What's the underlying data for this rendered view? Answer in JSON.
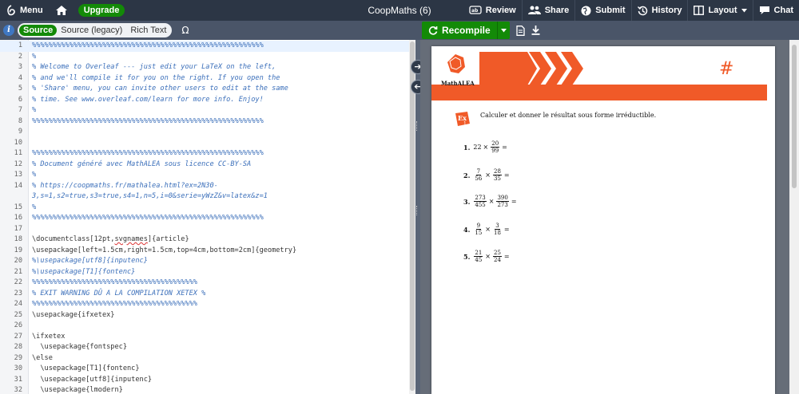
{
  "topbar": {
    "menu_label": "Menu",
    "upgrade_label": "Upgrade",
    "project_title": "CoopMaths (6)",
    "review_label": "Review",
    "share_label": "Share",
    "submit_label": "Submit",
    "history_label": "History",
    "layout_label": "Layout",
    "chat_label": "Chat"
  },
  "editor_toolbar": {
    "modes": [
      "Source",
      "Source (legacy)",
      "Rich Text"
    ],
    "active_mode": "Source",
    "omega": "Ω"
  },
  "preview_toolbar": {
    "recompile_label": "Recompile"
  },
  "code": [
    {
      "n": "1",
      "t": "%%%%%%%%%%%%%%%%%%%%%%%%%%%%%%%%%%%%%%%%%%%%%%%%%%%%%%%%",
      "k": "comment"
    },
    {
      "n": "2",
      "t": "%",
      "k": "comment"
    },
    {
      "n": "3",
      "t": "% Welcome to Overleaf --- just edit your LaTeX on the left,",
      "k": "comment"
    },
    {
      "n": "4",
      "t": "% and we'll compile it for you on the right. If you open the",
      "k": "comment"
    },
    {
      "n": "5",
      "t": "% 'Share' menu, you can invite other users to edit at the same",
      "k": "comment"
    },
    {
      "n": "6",
      "t": "% time. See www.overleaf.com/learn for more info. Enjoy!",
      "k": "comment"
    },
    {
      "n": "7",
      "t": "%",
      "k": "comment"
    },
    {
      "n": "8",
      "t": "%%%%%%%%%%%%%%%%%%%%%%%%%%%%%%%%%%%%%%%%%%%%%%%%%%%%%%%%",
      "k": "comment"
    },
    {
      "n": "9",
      "t": "",
      "k": "plain"
    },
    {
      "n": "10",
      "t": "",
      "k": "plain"
    },
    {
      "n": "11",
      "t": "%%%%%%%%%%%%%%%%%%%%%%%%%%%%%%%%%%%%%%%%%%%%%%%%%%%%%%%%",
      "k": "comment"
    },
    {
      "n": "12",
      "t": "% Document généré avec MathALEA sous licence CC-BY-SA",
      "k": "comment"
    },
    {
      "n": "13",
      "t": "%",
      "k": "comment"
    },
    {
      "n": "14",
      "t": "% https://coopmaths.fr/mathalea.html?ex=2N30-",
      "k": "comment"
    },
    {
      "n": "",
      "t": "3,s=1,s2=true,s3=true,s4=1,n=5,i=0&serie=yWzZ&v=latex&z=1",
      "k": "comment"
    },
    {
      "n": "15",
      "t": "%",
      "k": "comment"
    },
    {
      "n": "16",
      "t": "%%%%%%%%%%%%%%%%%%%%%%%%%%%%%%%%%%%%%%%%%%%%%%%%%%%%%%%%",
      "k": "comment"
    },
    {
      "n": "17",
      "t": "",
      "k": "plain"
    },
    {
      "n": "18",
      "t": "\\documentclass[12pt,svgnames]{article}",
      "k": "cmd"
    },
    {
      "n": "19",
      "t": "\\usepackage[left=1.5cm,right=1.5cm,top=4cm,bottom=2cm]{geometry}",
      "k": "cmd"
    },
    {
      "n": "20",
      "t": "%\\usepackage[utf8]{inputenc}",
      "k": "comment"
    },
    {
      "n": "21",
      "t": "%\\usepackage[T1]{fontenc}",
      "k": "comment"
    },
    {
      "n": "22",
      "t": "%%%%%%%%%%%%%%%%%%%%%%%%%%%%%%%%%%%%%%%%",
      "k": "comment"
    },
    {
      "n": "23",
      "t": "% EXIT WARNING DÛ A LA COMPILATION XETEX %",
      "k": "comment"
    },
    {
      "n": "24",
      "t": "%%%%%%%%%%%%%%%%%%%%%%%%%%%%%%%%%%%%%%%%",
      "k": "comment"
    },
    {
      "n": "25",
      "t": "\\usepackage{ifxetex}",
      "k": "cmd"
    },
    {
      "n": "26",
      "t": "",
      "k": "plain"
    },
    {
      "n": "27",
      "t": "\\ifxetex",
      "k": "cmd"
    },
    {
      "n": "28",
      "t": "  \\usepackage{fontspec}",
      "k": "cmd"
    },
    {
      "n": "29",
      "t": "\\else",
      "k": "cmd"
    },
    {
      "n": "30",
      "t": "  \\usepackage[T1]{fontenc}",
      "k": "cmd"
    },
    {
      "n": "31",
      "t": "  \\usepackage[utf8]{inputenc}",
      "k": "cmd"
    },
    {
      "n": "32",
      "t": "  \\usepackage{lmodern}",
      "k": "cmd"
    }
  ],
  "document": {
    "logo_text": "MathALEA",
    "hash_symbol": "#",
    "exercise_badge": "Ex 1",
    "instruction": "Calculer et donner le résultat sous forme irréductible.",
    "colors": {
      "accent": "#f05a28"
    },
    "items": [
      {
        "n": "1.",
        "a_int": "22",
        "op": "×",
        "b_num": "20",
        "b_den": "99",
        "eq": "="
      },
      {
        "n": "2.",
        "a_num": "7",
        "a_den": "56",
        "op": "×",
        "b_num": "28",
        "b_den": "35",
        "eq": "="
      },
      {
        "n": "3.",
        "a_num": "273",
        "a_den": "455",
        "op": "×",
        "b_num": "390",
        "b_den": "273",
        "eq": "="
      },
      {
        "n": "4.",
        "a_num": "9",
        "a_den": "15",
        "op": "×",
        "b_num": "3",
        "b_den": "18",
        "eq": "="
      },
      {
        "n": "5.",
        "a_num": "21",
        "a_den": "45",
        "op": "×",
        "b_num": "25",
        "b_den": "24",
        "eq": "="
      }
    ]
  }
}
